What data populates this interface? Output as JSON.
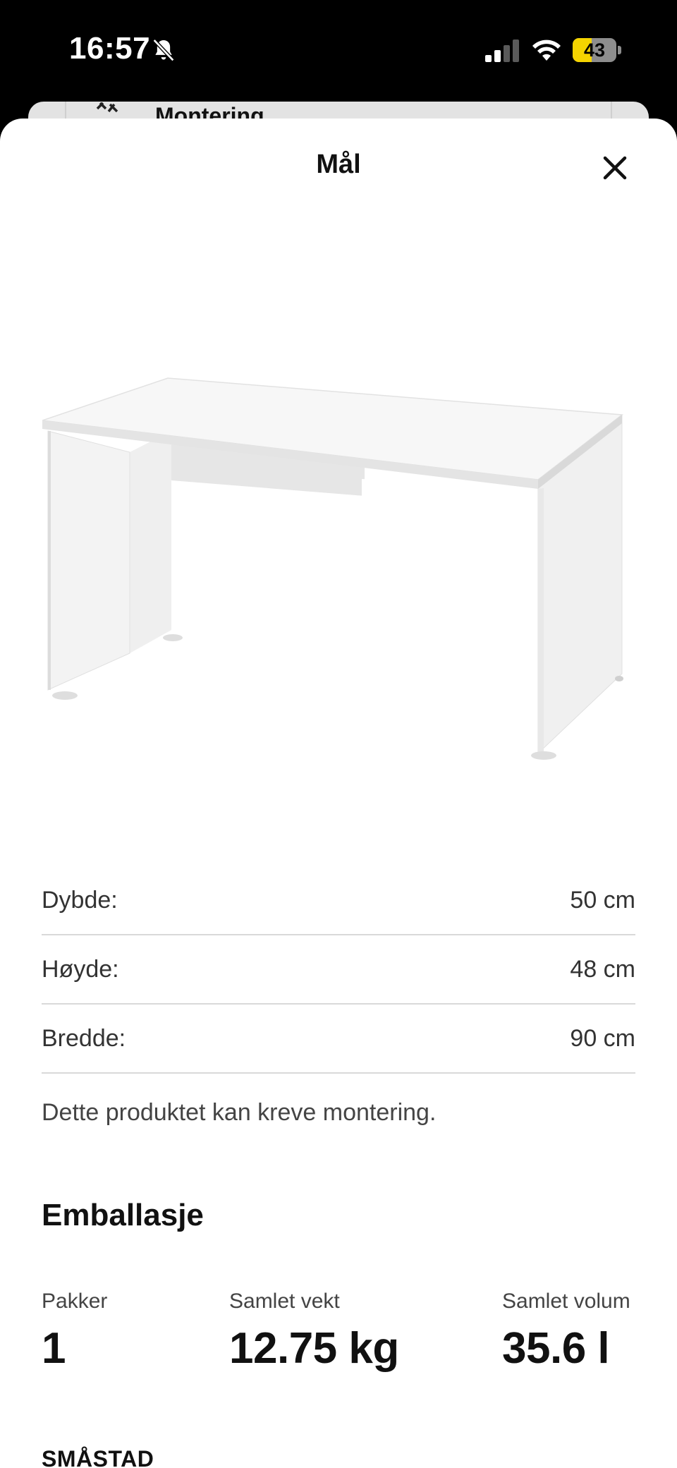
{
  "status_bar": {
    "time": "16:57",
    "battery": "43",
    "battery_level": 0.43,
    "battery_color": "#f5d400",
    "icons": [
      "bell-off-icon",
      "cellular-signal-icon",
      "wifi-icon",
      "battery-icon"
    ]
  },
  "background_sheet": {
    "label": "Montering",
    "icon": "tools-icon"
  },
  "sheet": {
    "title": "Mål",
    "close_icon": "close-icon"
  },
  "product_image": {
    "alt": "white bench illustration"
  },
  "dimensions": [
    {
      "label": "Dybde:",
      "value": "50 cm"
    },
    {
      "label": "Høyde:",
      "value": "48 cm"
    },
    {
      "label": "Bredde:",
      "value": "90 cm"
    }
  ],
  "assembly_note": "Dette produktet kan kreve montering.",
  "packaging": {
    "title": "Emballasje",
    "stats": [
      {
        "label": "Pakker",
        "value": "1"
      },
      {
        "label": "Samlet vekt",
        "value": "12.75 kg"
      },
      {
        "label": "Samlet volum",
        "value": "35.6 l"
      }
    ]
  },
  "product_name": "SMÅSTAD"
}
